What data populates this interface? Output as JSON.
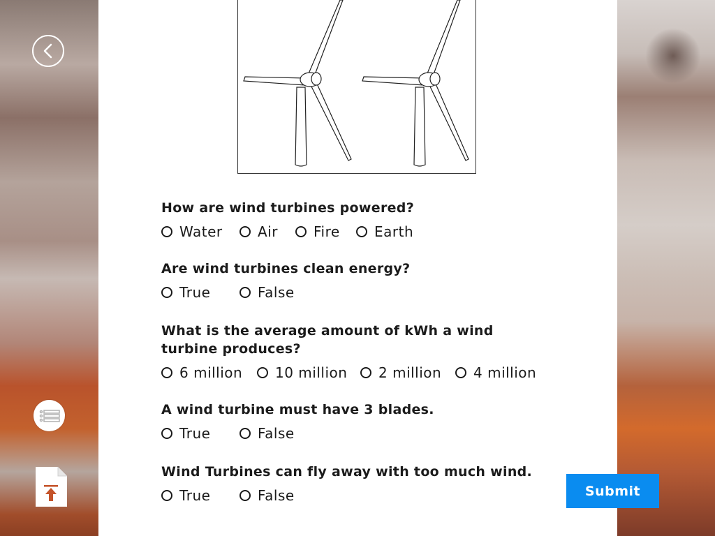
{
  "nav": {
    "back_icon": "chevron-left-icon",
    "toc_icon": "list-icon",
    "export_icon": "file-upload-icon"
  },
  "questions": [
    {
      "title": "How are wind turbines powered?",
      "options": [
        "Water",
        "Air",
        "Fire",
        "Earth"
      ]
    },
    {
      "title": "Are wind turbines clean energy?",
      "options": [
        "True",
        "False"
      ]
    },
    {
      "title": "What is the average amount of kWh a wind turbine produces?",
      "options": [
        "6 million",
        "10 million",
        "2 million",
        "4 million"
      ]
    },
    {
      "title": "A wind turbine must have 3 blades.",
      "options": [
        "True",
        "False"
      ]
    },
    {
      "title": "Wind Turbines can fly away with too much wind.",
      "options": [
        "True",
        "False"
      ]
    }
  ],
  "submit_label": "Submit",
  "colors": {
    "accent": "#0a8cf0",
    "text": "#1b1b1b"
  }
}
